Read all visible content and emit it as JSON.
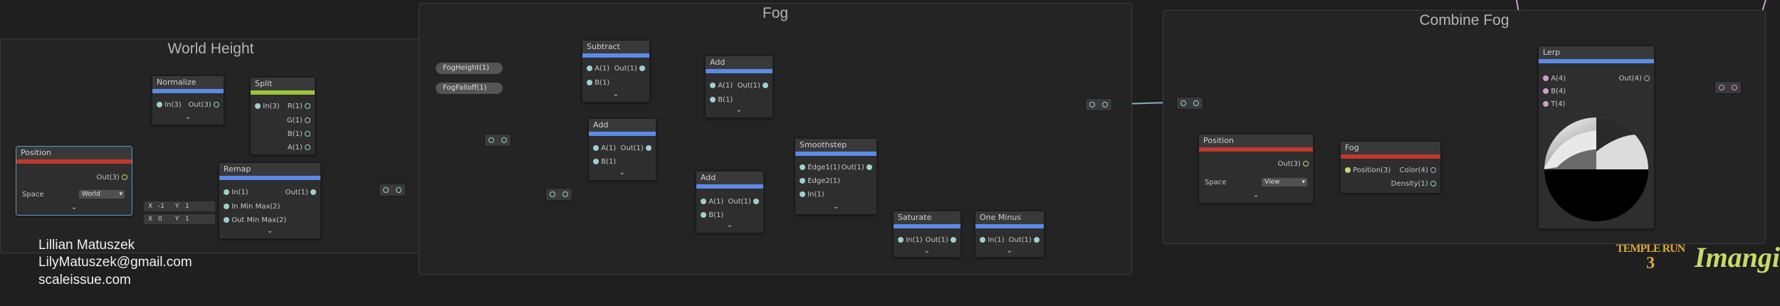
{
  "groups": {
    "world_height": {
      "title": "World Height"
    },
    "fog": {
      "title": "Fog"
    },
    "combine_fog": {
      "title": "Combine Fog"
    }
  },
  "nodes": {
    "normalize": {
      "title": "Normalize",
      "in": "In(3)",
      "out": "Out(3)"
    },
    "split": {
      "title": "Split",
      "in": "In(3)",
      "r": "R(1)",
      "g": "G(1)",
      "b": "B(1)",
      "a": "A(1)"
    },
    "position1": {
      "title": "Position",
      "out": "Out(3)",
      "space_label": "Space",
      "space_value": "World"
    },
    "remap": {
      "title": "Remap",
      "in": "In(1)",
      "inmm": "In Min Max(2)",
      "outmm": "Out Min Max(2)",
      "out": "Out(1)"
    },
    "remap_in": {
      "x_label": "X",
      "x_val": "-1",
      "y_label": "Y",
      "y_val": "1"
    },
    "remap_out": {
      "x_label": "X",
      "x_val": "0",
      "y_label": "Y",
      "y_val": "1"
    },
    "subtract": {
      "title": "Subtract",
      "a": "A(1)",
      "b": "B(1)",
      "out": "Out(1)"
    },
    "add1": {
      "title": "Add",
      "a": "A(1)",
      "b": "B(1)",
      "out": "Out(1)"
    },
    "add2": {
      "title": "Add",
      "a": "A(1)",
      "b": "B(1)",
      "out": "Out(1)"
    },
    "add3": {
      "title": "Add",
      "a": "A(1)",
      "b": "B(1)",
      "out": "Out(1)"
    },
    "smoothstep": {
      "title": "Smoothstep",
      "e1": "Edge1(1)",
      "e2": "Edge2(1)",
      "in": "In(1)",
      "out": "Out(1)"
    },
    "saturate": {
      "title": "Saturate",
      "in": "In(1)",
      "out": "Out(1)"
    },
    "oneminus": {
      "title": "One Minus",
      "in": "In(1)",
      "out": "Out(1)"
    },
    "position2": {
      "title": "Position",
      "out": "Out(3)",
      "space_label": "Space",
      "space_value": "View"
    },
    "fog": {
      "title": "Fog",
      "in": "Position(3)",
      "color": "Color(4)",
      "density": "Density(1)"
    },
    "lerp": {
      "title": "Lerp",
      "a": "A(4)",
      "b": "B(4)",
      "t": "T(4)",
      "out": "Out(4)"
    }
  },
  "properties": {
    "fog_height": "FogHeight(1)",
    "fog_falloff": "FogFalloff(1)"
  },
  "credits": {
    "name": "Lillian Matuszek",
    "email": "LilyMatuszek@gmail.com",
    "site": "scaleissue.com"
  },
  "logos": {
    "temple_run_line1": "TEMPLE RUN",
    "temple_run_line2": "3",
    "imangi": "Imangi"
  },
  "colors": {
    "bg": "#1f1f1f",
    "float_port": "#9fd0d0",
    "vector_header": "#5c8ae6",
    "position_header": "#c0392b",
    "split_header": "#9bc53d",
    "wire_float": "#7fb8b8",
    "wire_vec": "#d3d27a",
    "wire_color": "#c8a2c8"
  }
}
